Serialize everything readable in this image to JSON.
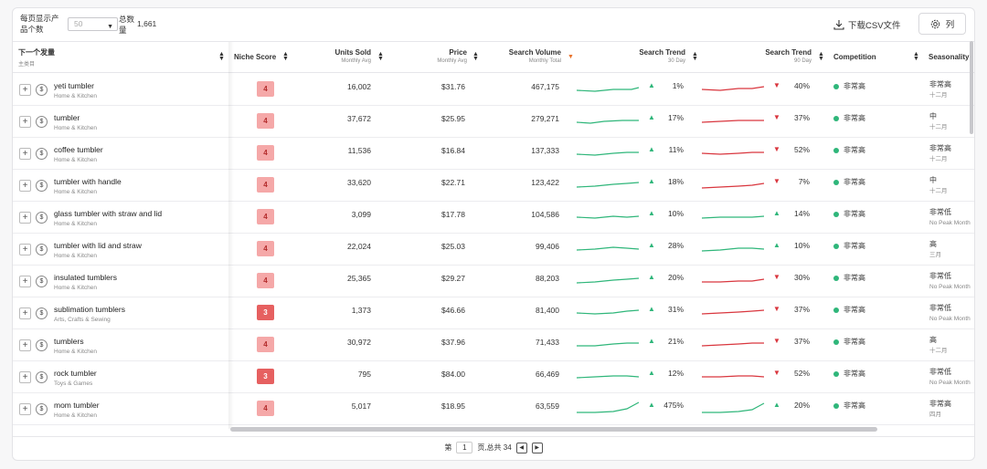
{
  "toolbar": {
    "per_page_label": "每页显示产品个数",
    "per_page_value": "50",
    "total_label": "总数量",
    "total_value": "1,661",
    "download_label": "下载CSV文件",
    "columns_label": "列"
  },
  "columns": {
    "keyword": {
      "label": "下一个发量",
      "sub": "主类目"
    },
    "niche": {
      "label": "Niche Score"
    },
    "units": {
      "label": "Units Sold",
      "sub": "Monthly Avg"
    },
    "price": {
      "label": "Price",
      "sub": "Monthly Avg"
    },
    "volume": {
      "label": "Search Volume",
      "sub": "Monthly Total"
    },
    "trend30": {
      "label": "Search Trend",
      "sub": "30 Day"
    },
    "trend90": {
      "label": "Search Trend",
      "sub": "90 Day"
    },
    "competition": {
      "label": "Competition"
    },
    "seasonality": {
      "label": "Seasonality"
    }
  },
  "colors": {
    "score_light": "#f5a8a8",
    "score_dark": "#e66060",
    "up": "#2fb67a",
    "down": "#d9363e"
  },
  "rows": [
    {
      "keyword": "yeti tumbler",
      "category": "Home & Kitchen",
      "score": "4",
      "units": "16,002",
      "price": "$31.76",
      "volume": "467,175",
      "t30": "1%",
      "t30_up": true,
      "t90": "40%",
      "t90_up": false,
      "comp": "非常高",
      "season": "非常高",
      "season_sub": "十二月"
    },
    {
      "keyword": "tumbler",
      "category": "Home & Kitchen",
      "score": "4",
      "units": "37,672",
      "price": "$25.95",
      "volume": "279,271",
      "t30": "17%",
      "t30_up": true,
      "t90": "37%",
      "t90_up": false,
      "comp": "非常高",
      "season": "中",
      "season_sub": "十二月"
    },
    {
      "keyword": "coffee tumbler",
      "category": "Home & Kitchen",
      "score": "4",
      "units": "11,536",
      "price": "$16.84",
      "volume": "137,333",
      "t30": "11%",
      "t30_up": true,
      "t90": "52%",
      "t90_up": false,
      "comp": "非常高",
      "season": "非常高",
      "season_sub": "十二月"
    },
    {
      "keyword": "tumbler with handle",
      "category": "Home & Kitchen",
      "score": "4",
      "units": "33,620",
      "price": "$22.71",
      "volume": "123,422",
      "t30": "18%",
      "t30_up": true,
      "t90": "7%",
      "t90_up": false,
      "comp": "非常高",
      "season": "中",
      "season_sub": "十二月"
    },
    {
      "keyword": "glass tumbler with straw and lid",
      "category": "Home & Kitchen",
      "score": "4",
      "units": "3,099",
      "price": "$17.78",
      "volume": "104,586",
      "t30": "10%",
      "t30_up": true,
      "t90": "14%",
      "t90_up": true,
      "comp": "非常高",
      "season": "非常低",
      "season_sub": "No Peak Month"
    },
    {
      "keyword": "tumbler with lid and straw",
      "category": "Home & Kitchen",
      "score": "4",
      "units": "22,024",
      "price": "$25.03",
      "volume": "99,406",
      "t30": "28%",
      "t30_up": true,
      "t90": "10%",
      "t90_up": true,
      "comp": "非常高",
      "season": "高",
      "season_sub": "三月"
    },
    {
      "keyword": "insulated tumblers",
      "category": "Home & Kitchen",
      "score": "4",
      "units": "25,365",
      "price": "$29.27",
      "volume": "88,203",
      "t30": "20%",
      "t30_up": true,
      "t90": "30%",
      "t90_up": false,
      "comp": "非常高",
      "season": "非常低",
      "season_sub": "No Peak Month"
    },
    {
      "keyword": "sublimation tumblers",
      "category": "Arts, Crafts & Sewing",
      "score": "3",
      "units": "1,373",
      "price": "$46.66",
      "volume": "81,400",
      "t30": "31%",
      "t30_up": true,
      "t90": "37%",
      "t90_up": false,
      "comp": "非常高",
      "season": "非常低",
      "season_sub": "No Peak Month"
    },
    {
      "keyword": "tumblers",
      "category": "Home & Kitchen",
      "score": "4",
      "units": "30,972",
      "price": "$37.96",
      "volume": "71,433",
      "t30": "21%",
      "t30_up": true,
      "t90": "37%",
      "t90_up": false,
      "comp": "非常高",
      "season": "高",
      "season_sub": "十二月"
    },
    {
      "keyword": "rock tumbler",
      "category": "Toys & Games",
      "score": "3",
      "units": "795",
      "price": "$84.00",
      "volume": "66,469",
      "t30": "12%",
      "t30_up": true,
      "t90": "52%",
      "t90_up": false,
      "comp": "非常高",
      "season": "非常低",
      "season_sub": "No Peak Month"
    },
    {
      "keyword": "mom tumbler",
      "category": "Home & Kitchen",
      "score": "4",
      "units": "5,017",
      "price": "$18.95",
      "volume": "63,559",
      "t30": "475%",
      "t30_up": true,
      "t90": "20%",
      "t90_up": true,
      "comp": "非常高",
      "season": "非常高",
      "season_sub": "四月"
    }
  ],
  "pager": {
    "page_label": "第",
    "page": "1",
    "total_label": "页,总共 34"
  }
}
